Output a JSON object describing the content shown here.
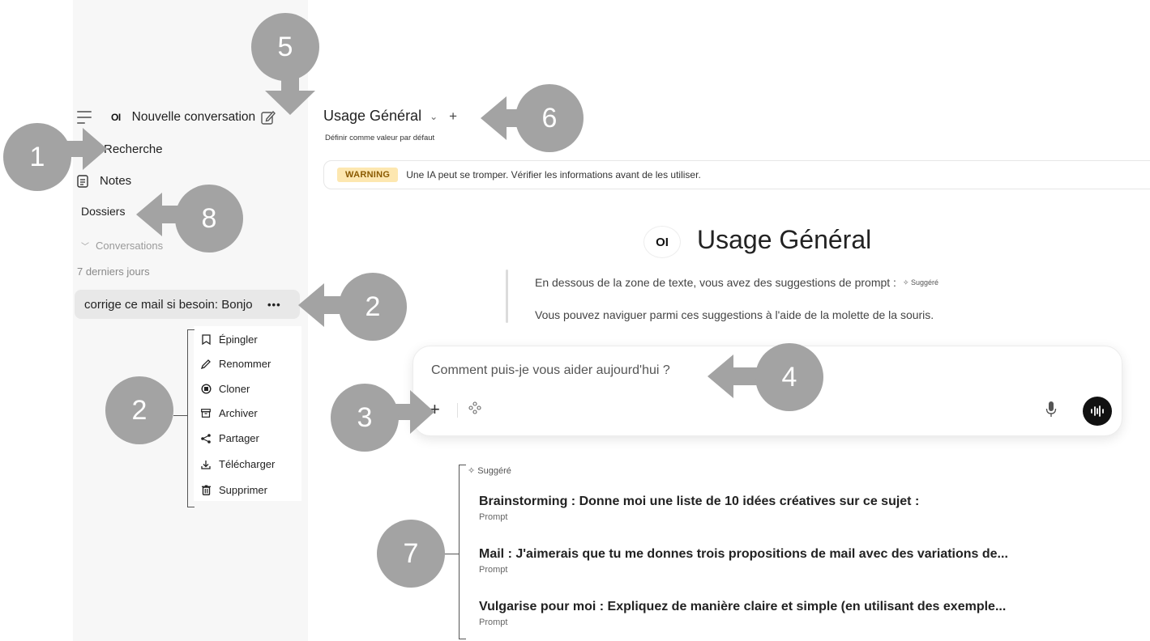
{
  "sidebar": {
    "logo": "OI",
    "new_chat": "Nouvelle conversation",
    "search": "Recherche",
    "notes": "Notes",
    "folders": "Dossiers",
    "conversations": "Conversations",
    "period": "7 derniers jours",
    "chat_title": "corrige ce mail si besoin: Bonjour",
    "chat_more": "•••"
  },
  "context_menu": {
    "items": [
      {
        "label": "Épingler",
        "icon": "pin-icon"
      },
      {
        "label": "Renommer",
        "icon": "pencil-icon"
      },
      {
        "label": "Cloner",
        "icon": "clone-icon"
      },
      {
        "label": "Archiver",
        "icon": "archive-icon"
      },
      {
        "label": "Partager",
        "icon": "share-icon"
      },
      {
        "label": "Télécharger",
        "icon": "download-icon"
      },
      {
        "label": "Supprimer",
        "icon": "trash-icon"
      }
    ]
  },
  "header": {
    "model": "Usage Général",
    "chevron": "⌄",
    "plus": "+",
    "set_default": "Définir comme valeur par défaut"
  },
  "warning": {
    "badge": "WARNING",
    "text": "Une IA peut se tromper. Vérifier les informations avant de les utiliser."
  },
  "hero": {
    "logo": "OI",
    "title": "Usage Général",
    "hint1": "En dessous de la zone de texte, vous avez des suggestions de prompt :",
    "hint1_tag": "Suggéré",
    "hint2": "Vous pouvez naviguer parmi ces suggestions à l'aide de la molette de la souris."
  },
  "input": {
    "placeholder": "Comment puis-je vous aider aujourd'hui ?",
    "add": "+"
  },
  "suggestions": {
    "label": "Suggéré",
    "items": [
      {
        "title": "Brainstorming : Donne moi une liste de 10 idées créatives sur ce sujet :",
        "sub": "Prompt"
      },
      {
        "title": "Mail : J'aimerais que tu me donnes trois propositions de mail avec des variations de...",
        "sub": "Prompt"
      },
      {
        "title": "Vulgarise pour moi : Expliquez de manière claire et simple (en utilisant des exemple...",
        "sub": "Prompt"
      }
    ]
  },
  "callouts": {
    "c1": "1",
    "c2a": "2",
    "c2b": "2",
    "c3": "3",
    "c4": "4",
    "c5": "5",
    "c6": "6",
    "c7": "7",
    "c8": "8"
  },
  "colors": {
    "sidebar_bg": "#f7f7f7",
    "callout": "#a3a3a3",
    "warning_bg": "#fde7b0",
    "warning_fg": "#8a5a00"
  }
}
